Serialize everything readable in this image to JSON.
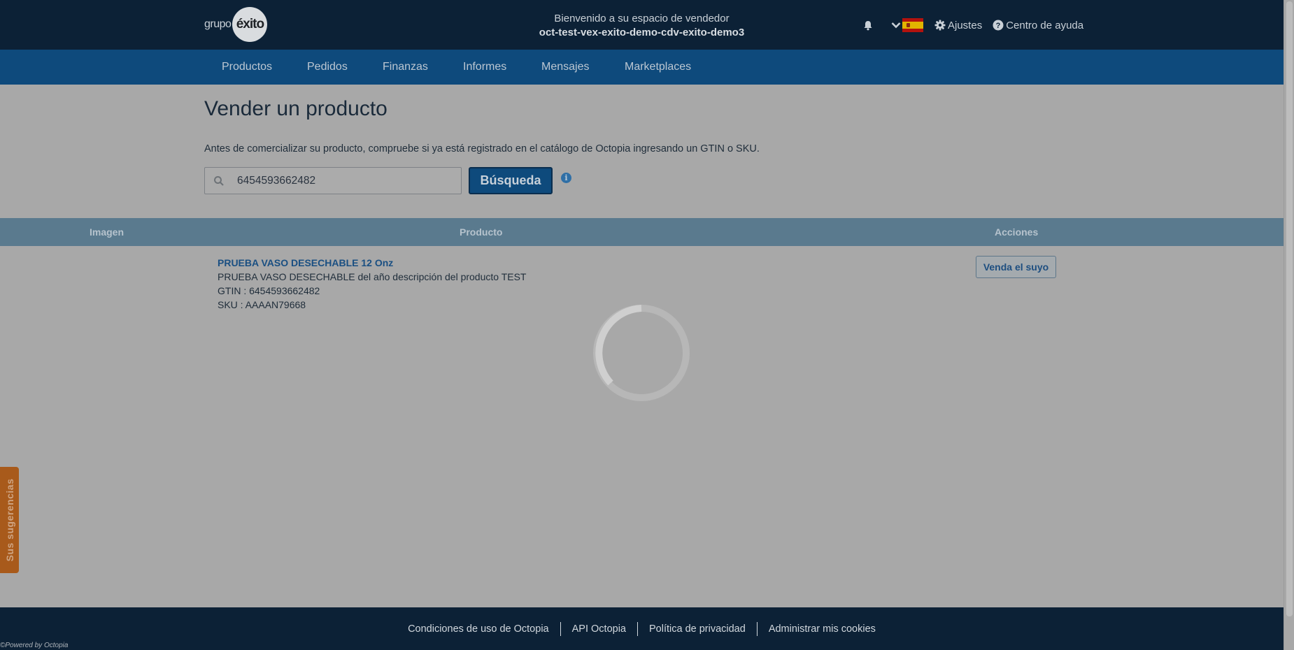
{
  "header": {
    "logo_text": "grupo",
    "logo_mark": "éxito",
    "welcome": "Bienvenido a su espacio de vendedor",
    "seller_id": "oct-test-vex-exito-demo-cdv-exito-demo3",
    "icons": [
      "bell-icon",
      "chevron-down-icon",
      "spain-flag-icon",
      "gear-icon",
      "help-circle-icon"
    ],
    "settings_label": "Ajustes",
    "help_label": "Centro de ayuda"
  },
  "nav": {
    "items": [
      "Productos",
      "Pedidos",
      "Finanzas",
      "Informes",
      "Mensajes",
      "Marketplaces"
    ]
  },
  "main": {
    "title": "Vender un producto",
    "intro": "Antes de comercializar su producto, compruebe si ya está registrado en el catálogo de Octopia ingresando un GTIN o SKU.",
    "search": {
      "value": "6454593662482",
      "button_label": "Búsqueda"
    }
  },
  "table": {
    "headers": [
      "Imagen",
      "Producto",
      "Acciones"
    ],
    "rows": [
      {
        "name": "PRUEBA VASO DESECHABLE 12 Onz",
        "description": "PRUEBA VASO DESECHABLE del año descripción del producto TEST",
        "gtin": "GTIN : 6454593662482",
        "sku": "SKU : AAAAN79668",
        "action_label": "Venda el suyo"
      }
    ]
  },
  "suggestions_tab": "Sus sugerencias",
  "footer": {
    "links": [
      "Condiciones de uso de Octopia",
      "API Octopia",
      "Política de privacidad",
      "Administrar mis cookies"
    ],
    "powered": "©Powered by Octopia"
  },
  "colors": {
    "header_bg": "#0c2136",
    "nav_bg": "#0e4a7c",
    "table_head_bg": "#5a7a8e",
    "overlay_bg": "#a8a8a8",
    "suggestions_bg": "#a85a1b"
  }
}
